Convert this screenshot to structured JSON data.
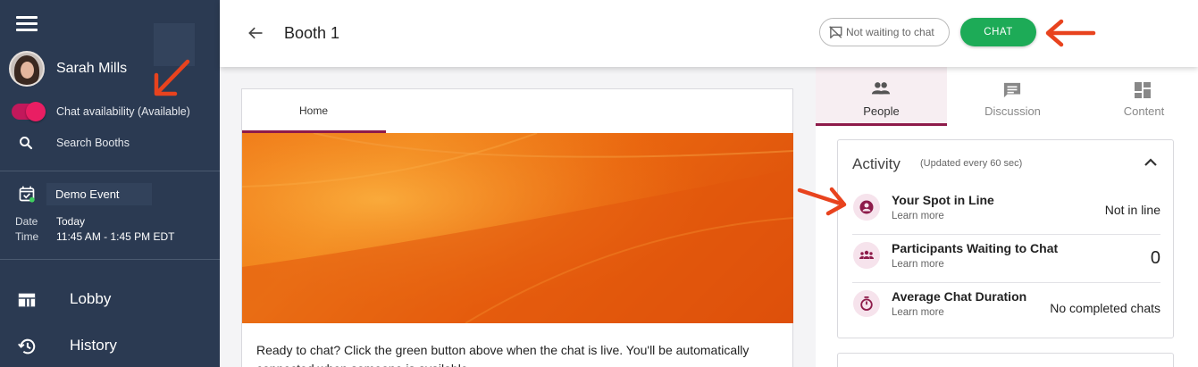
{
  "sidebar": {
    "user_name": "Sarah Mills",
    "availability_label": "Chat availability (Available)",
    "search_label": "Search Booths",
    "event_name": "Demo Event",
    "date_key": "Date",
    "date_value": "Today",
    "time_key": "Time",
    "time_value": "11:45 AM - 1:45 PM EDT",
    "nav": [
      {
        "label": "Lobby",
        "icon": "lobby-icon"
      },
      {
        "label": "History",
        "icon": "history-icon"
      }
    ]
  },
  "header": {
    "title": "Booth 1",
    "not_waiting_label": "Not waiting to chat",
    "chat_label": "CHAT"
  },
  "main": {
    "tab_home": "Home",
    "body_text": "Ready to chat? Click the green button above when the chat is live. You'll be automatically connected when someone is available."
  },
  "right_panel": {
    "tabs": [
      {
        "label": "People",
        "icon": "people-icon",
        "active": true
      },
      {
        "label": "Discussion",
        "icon": "discussion-icon",
        "active": false
      },
      {
        "label": "Content",
        "icon": "content-icon",
        "active": false
      }
    ],
    "activity": {
      "title": "Activity",
      "subtitle": "(Updated every 60 sec)",
      "rows": [
        {
          "label": "Your Spot in Line",
          "learn": "Learn more",
          "value": "Not in line"
        },
        {
          "label": "Participants Waiting to Chat",
          "learn": "Learn more",
          "value": "0"
        },
        {
          "label": "Average Chat Duration",
          "learn": "Learn more",
          "value": "No completed chats"
        }
      ]
    }
  },
  "colors": {
    "sidebar": "#2b3a52",
    "accent": "#8e1b4a",
    "chat_green": "#1dab57",
    "annotation_arrow": "#e8431e"
  }
}
